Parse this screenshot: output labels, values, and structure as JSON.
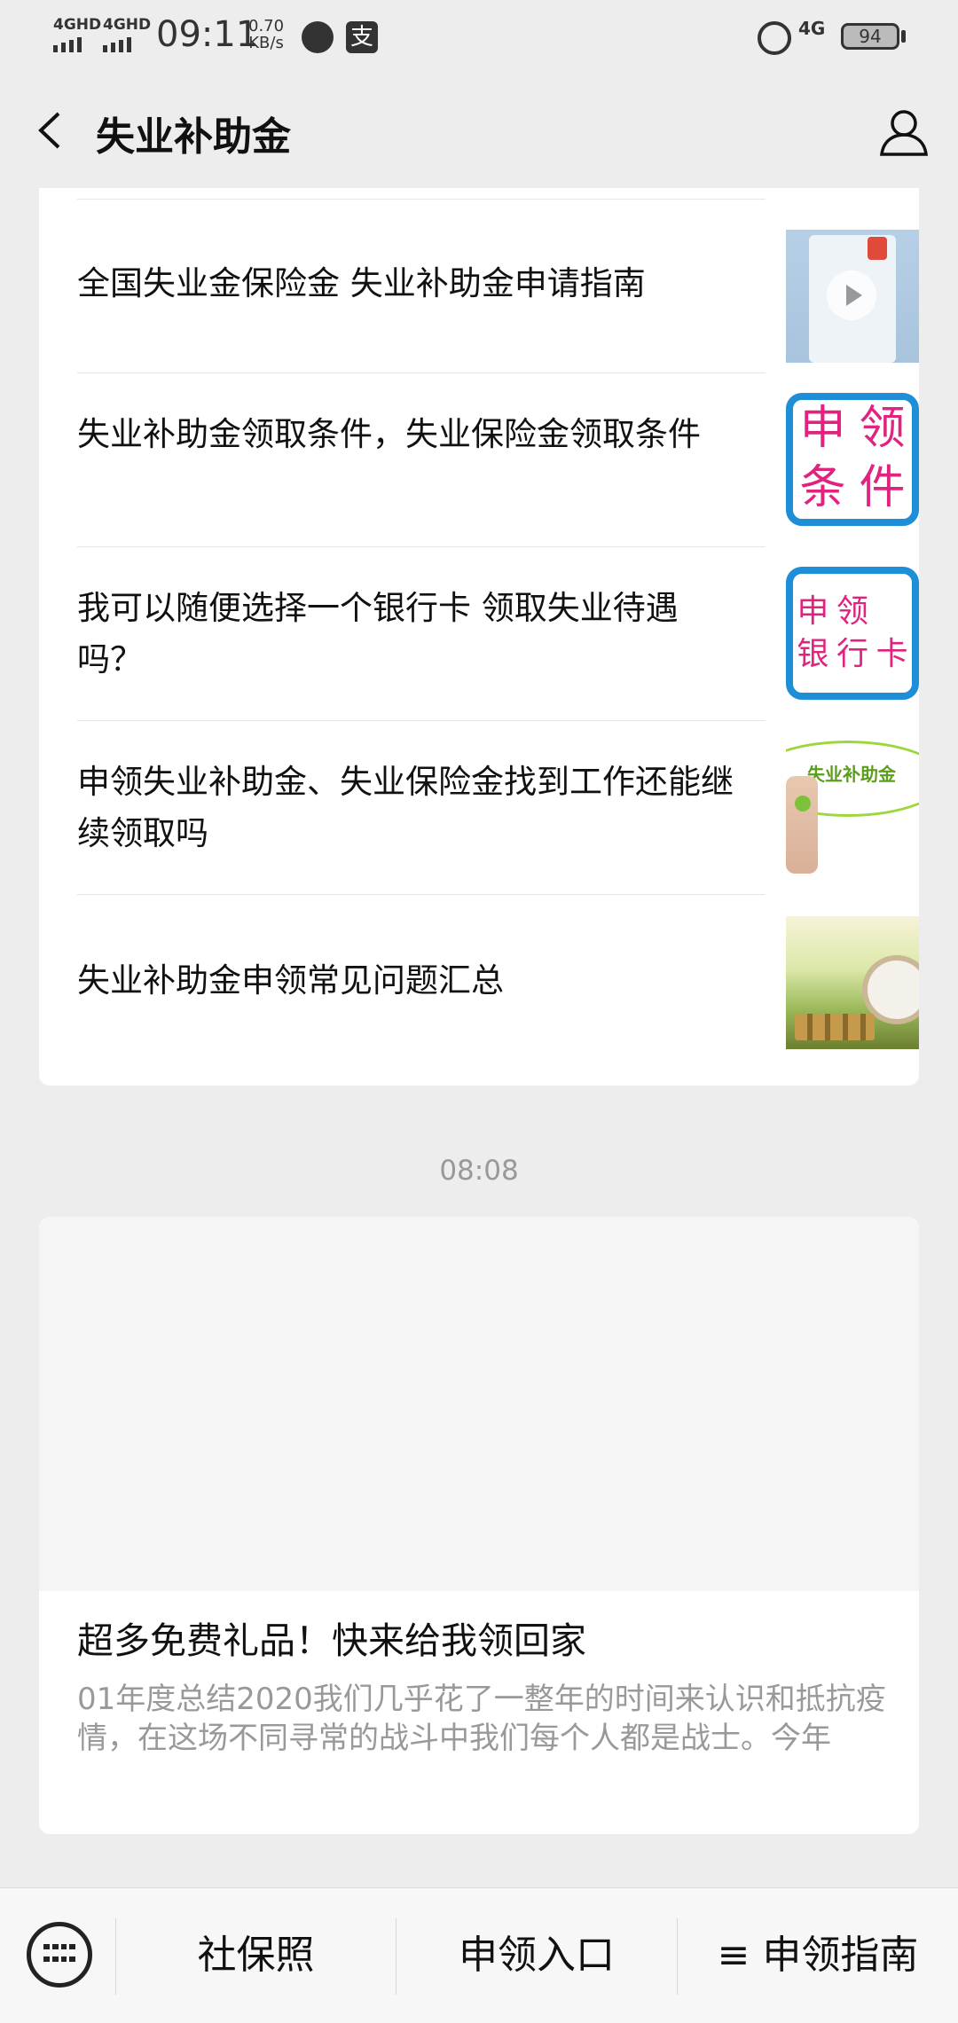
{
  "status_bar": {
    "signal1": "4GHD",
    "signal2": "4GHD",
    "time": "09:11",
    "net_speed_value": "0.70",
    "net_speed_unit": "KB/s",
    "alipay_glyph": "支",
    "network": "4G",
    "battery": "94"
  },
  "header": {
    "title": "失业补助金"
  },
  "articles": [
    {
      "title": "全国失业金保险金 失业补助金申请指南",
      "thumb": "video-thumbnail"
    },
    {
      "title": "失业补助金领取条件，失业保险金领取条件",
      "thumb_text": [
        "申",
        "领",
        "条",
        "件"
      ]
    },
    {
      "title": "我可以随便选择一个银行卡 领取失业待遇吗？",
      "thumb_text": [
        "申",
        "领",
        "银",
        "行",
        "卡"
      ]
    },
    {
      "title": "申领失业补助金、失业保险金找到工作还能继续领取吗",
      "thumb_text": [
        "失业补助金"
      ]
    },
    {
      "title": "失业补助金申领常见问题汇总",
      "thumb": "clock-coins-image"
    }
  ],
  "message_time": "08:08",
  "card2": {
    "title": "超多免费礼品！快来给我领回家",
    "description": "01年度总结2020我们几乎花了一整年的时间来认识和抵抗疫情，在这场不同寻常的战斗中我们每个人都是战士。今年"
  },
  "bottom_menu": {
    "items": [
      "社保照",
      "申领入口",
      "≡ 申领指南"
    ]
  }
}
